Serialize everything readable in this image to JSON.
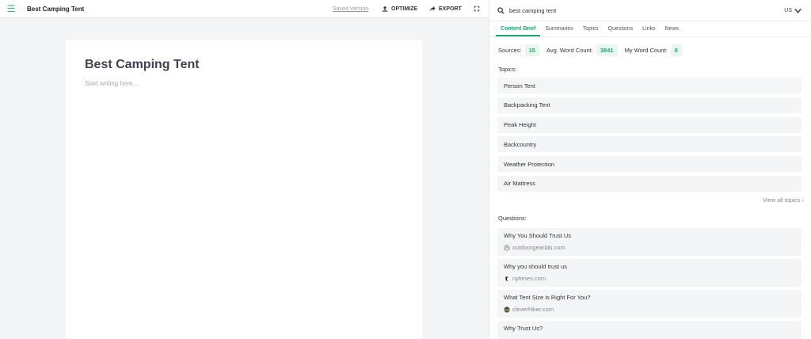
{
  "toolbar": {
    "doc_title": "Best Camping Tent",
    "saved_version": "Saved Version",
    "optimize_label": "OPTIMIZE",
    "export_label": "EXPORT"
  },
  "editor": {
    "title": "Best Camping Tent",
    "placeholder": "Start writing here..."
  },
  "panel": {
    "search_value": "best camping tent",
    "country": "US",
    "tabs": [
      "Content Brief",
      "Summaries",
      "Topics",
      "Questions",
      "Links",
      "News"
    ],
    "active_tab": "Content Brief",
    "stats": {
      "sources_label": "Sources:",
      "sources_value": "15",
      "avg_label": "Avg. Word Count:",
      "avg_value": "3841",
      "my_label": "My Word Count:",
      "my_value": "0"
    },
    "topics_label": "Topics:",
    "topics": [
      "Person Tent",
      "Backpacking Tent",
      "Peak Height",
      "Backcountry",
      "Weather Protection",
      "Air Mattress"
    ],
    "view_all": "View all topics",
    "questions_label": "Questions:",
    "questions": [
      {
        "title": "Why You Should Trust Us",
        "source": "outdoorgearlab.com"
      },
      {
        "title": "Why you should trust us",
        "source": "nytimes.com"
      },
      {
        "title": "What Tent Size is Right For You?",
        "source": "cleverhiker.com"
      },
      {
        "title": "Why Trust Us?",
        "source": ""
      }
    ],
    "colors": {
      "accent": "#1ea672",
      "badge_bg": "#eaf6f0"
    }
  }
}
